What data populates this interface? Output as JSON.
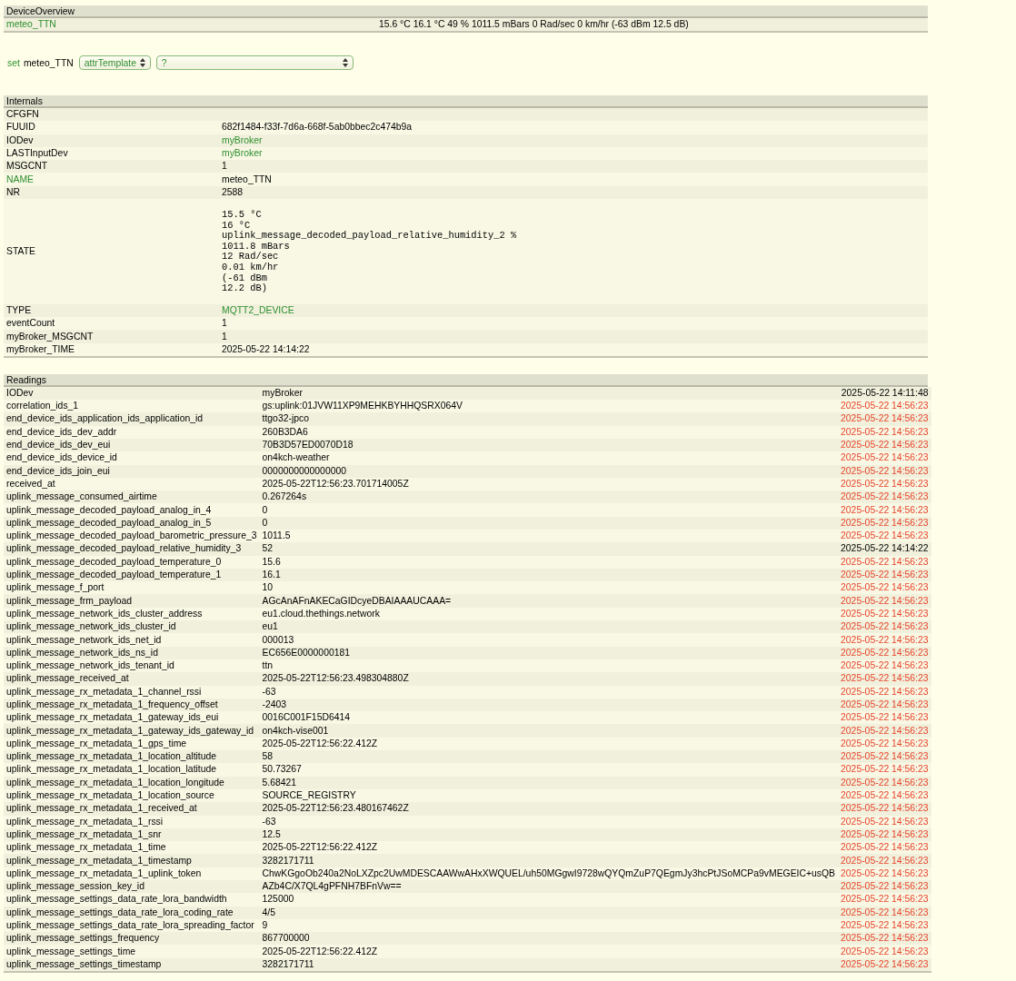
{
  "device_overview": {
    "title": "DeviceOverview",
    "device": "meteo_TTN",
    "state": "15.6 °C 16.1 °C 49 % 1011.5 mBars 0 Rad/sec 0 km/hr (-63 dBm 12.5 dB)"
  },
  "set_line": {
    "command": "set",
    "device": "meteo_TTN",
    "selects": [
      {
        "value": "attrTemplate"
      },
      {
        "value": "?"
      }
    ]
  },
  "internals": {
    "title": "Internals",
    "rows": [
      {
        "name": "CFGFN",
        "name_link": false
      },
      {
        "name": "FUUID",
        "name_link": false,
        "kind": "text",
        "value": "682f1484-f33f-7d6a-668f-5ab0bbec2c474b9a"
      },
      {
        "name": "IODev",
        "name_link": false,
        "kind": "link",
        "value": "myBroker"
      },
      {
        "name": "LASTInputDev",
        "name_link": false,
        "kind": "link",
        "value": "myBroker"
      },
      {
        "name": "MSGCNT",
        "name_link": false,
        "kind": "text",
        "value": "1"
      },
      {
        "name": "NAME",
        "name_link": true,
        "kind": "text",
        "value": "meteo_TTN"
      },
      {
        "name": "NR",
        "name_link": false,
        "kind": "text",
        "value": "2588"
      },
      {
        "name": "STATE",
        "name_link": false,
        "kind": "preformatted",
        "value": "15.5 °C\n16 °C\nuplink_message_decoded_payload_relative_humidity_2 %\n1011.8 mBars\n12 Rad/sec\n0.01 km/hr\n(-61 dBm\n12.2 dB)"
      },
      {
        "name": "TYPE",
        "name_link": false,
        "kind": "link",
        "value": "MQTT2_DEVICE"
      },
      {
        "name": "eventCount",
        "name_link": false,
        "kind": "text",
        "value": "1"
      },
      {
        "name": "myBroker_MSGCNT",
        "name_link": false,
        "kind": "text",
        "value": "1"
      },
      {
        "name": "myBroker_TIME",
        "name_link": false,
        "kind": "text",
        "value": "2025-05-22 14:14:22"
      }
    ]
  },
  "readings": {
    "title": "Readings",
    "rows": [
      {
        "name": "IODev",
        "value": "myBroker",
        "time": "2025-05-22 14:11:48",
        "color": "#000000"
      },
      {
        "name": "correlation_ids_1",
        "value": "gs:uplink:01JVW11XP9MEHKBYHHQSRX064V",
        "time": "2025-05-22 14:56:23",
        "color": "#e8452c"
      },
      {
        "name": "end_device_ids_application_ids_application_id",
        "value": "ttgo32-jpco",
        "time": "2025-05-22 14:56:23",
        "color": "#e8452c"
      },
      {
        "name": "end_device_ids_dev_addr",
        "value": "260B3DA6",
        "time": "2025-05-22 14:56:23",
        "color": "#e8452c"
      },
      {
        "name": "end_device_ids_dev_eui",
        "value": "70B3D57ED0070D18",
        "time": "2025-05-22 14:56:23",
        "color": "#e8452c"
      },
      {
        "name": "end_device_ids_device_id",
        "value": "on4kch-weather",
        "time": "2025-05-22 14:56:23",
        "color": "#e8452c"
      },
      {
        "name": "end_device_ids_join_eui",
        "value": "0000000000000000",
        "time": "2025-05-22 14:56:23",
        "color": "#e8452c"
      },
      {
        "name": "received_at",
        "value": "2025-05-22T12:56:23.701714005Z",
        "time": "2025-05-22 14:56:23",
        "color": "#e8452c"
      },
      {
        "name": "uplink_message_consumed_airtime",
        "value": "0.267264s",
        "time": "2025-05-22 14:56:23",
        "color": "#e8452c"
      },
      {
        "name": "uplink_message_decoded_payload_analog_in_4",
        "value": "0",
        "time": "2025-05-22 14:56:23",
        "color": "#e8452c"
      },
      {
        "name": "uplink_message_decoded_payload_analog_in_5",
        "value": "0",
        "time": "2025-05-22 14:56:23",
        "color": "#e8452c"
      },
      {
        "name": "uplink_message_decoded_payload_barometric_pressure_3",
        "value": "1011.5",
        "time": "2025-05-22 14:56:23",
        "color": "#e8452c"
      },
      {
        "name": "uplink_message_decoded_payload_relative_humidity_3",
        "value": "52",
        "time": "2025-05-22 14:14:22",
        "color": "#000000"
      },
      {
        "name": "uplink_message_decoded_payload_temperature_0",
        "value": "15.6",
        "time": "2025-05-22 14:56:23",
        "color": "#e8452c"
      },
      {
        "name": "uplink_message_decoded_payload_temperature_1",
        "value": "16.1",
        "time": "2025-05-22 14:56:23",
        "color": "#e8452c"
      },
      {
        "name": "uplink_message_f_port",
        "value": "10",
        "time": "2025-05-22 14:56:23",
        "color": "#e8452c"
      },
      {
        "name": "uplink_message_frm_payload",
        "value": "AGcAnAFnAKECaGIDcyeDBAIAAAUCAAA=",
        "time": "2025-05-22 14:56:23",
        "color": "#e8452c"
      },
      {
        "name": "uplink_message_network_ids_cluster_address",
        "value": "eu1.cloud.thethings.network",
        "time": "2025-05-22 14:56:23",
        "color": "#e8452c"
      },
      {
        "name": "uplink_message_network_ids_cluster_id",
        "value": "eu1",
        "time": "2025-05-22 14:56:23",
        "color": "#e8452c"
      },
      {
        "name": "uplink_message_network_ids_net_id",
        "value": "000013",
        "time": "2025-05-22 14:56:23",
        "color": "#e8452c"
      },
      {
        "name": "uplink_message_network_ids_ns_id",
        "value": "EC656E0000000181",
        "time": "2025-05-22 14:56:23",
        "color": "#e8452c"
      },
      {
        "name": "uplink_message_network_ids_tenant_id",
        "value": "ttn",
        "time": "2025-05-22 14:56:23",
        "color": "#e8452c"
      },
      {
        "name": "uplink_message_received_at",
        "value": "2025-05-22T12:56:23.498304880Z",
        "time": "2025-05-22 14:56:23",
        "color": "#e8452c"
      },
      {
        "name": "uplink_message_rx_metadata_1_channel_rssi",
        "value": "-63",
        "time": "2025-05-22 14:56:23",
        "color": "#e8452c"
      },
      {
        "name": "uplink_message_rx_metadata_1_frequency_offset",
        "value": "-2403",
        "time": "2025-05-22 14:56:23",
        "color": "#e8452c"
      },
      {
        "name": "uplink_message_rx_metadata_1_gateway_ids_eui",
        "value": "0016C001F15D6414",
        "time": "2025-05-22 14:56:23",
        "color": "#e8452c"
      },
      {
        "name": "uplink_message_rx_metadata_1_gateway_ids_gateway_id",
        "value": "on4kch-vise001",
        "time": "2025-05-22 14:56:23",
        "color": "#e8452c"
      },
      {
        "name": "uplink_message_rx_metadata_1_gps_time",
        "value": "2025-05-22T12:56:22.412Z",
        "time": "2025-05-22 14:56:23",
        "color": "#e8452c"
      },
      {
        "name": "uplink_message_rx_metadata_1_location_altitude",
        "value": "58",
        "time": "2025-05-22 14:56:23",
        "color": "#e8452c"
      },
      {
        "name": "uplink_message_rx_metadata_1_location_latitude",
        "value": "50.73267",
        "time": "2025-05-22 14:56:23",
        "color": "#e8452c"
      },
      {
        "name": "uplink_message_rx_metadata_1_location_longitude",
        "value": "5.68421",
        "time": "2025-05-22 14:56:23",
        "color": "#e8452c"
      },
      {
        "name": "uplink_message_rx_metadata_1_location_source",
        "value": "SOURCE_REGISTRY",
        "time": "2025-05-22 14:56:23",
        "color": "#e8452c"
      },
      {
        "name": "uplink_message_rx_metadata_1_received_at",
        "value": "2025-05-22T12:56:23.480167462Z",
        "time": "2025-05-22 14:56:23",
        "color": "#e8452c"
      },
      {
        "name": "uplink_message_rx_metadata_1_rssi",
        "value": "-63",
        "time": "2025-05-22 14:56:23",
        "color": "#e8452c"
      },
      {
        "name": "uplink_message_rx_metadata_1_snr",
        "value": "12.5",
        "time": "2025-05-22 14:56:23",
        "color": "#e8452c"
      },
      {
        "name": "uplink_message_rx_metadata_1_time",
        "value": "2025-05-22T12:56:22.412Z",
        "time": "2025-05-22 14:56:23",
        "color": "#e8452c"
      },
      {
        "name": "uplink_message_rx_metadata_1_timestamp",
        "value": "3282171711",
        "time": "2025-05-22 14:56:23",
        "color": "#e8452c"
      },
      {
        "name": "uplink_message_rx_metadata_1_uplink_token",
        "value": "ChwKGgoOb240a2NoLXZpc2UwMDESCAAWwAHxXWQUEL/uh50MGgwI9728wQYQmZuP7QEgmJy3hcPtJSoMCPa9vMEGEIC+usQB",
        "time": "2025-05-22 14:56:23",
        "color": "#e8452c"
      },
      {
        "name": "uplink_message_session_key_id",
        "value": "AZb4C/X7QL4gPFNH7BFnVw==",
        "time": "2025-05-22 14:56:23",
        "color": "#e8452c"
      },
      {
        "name": "uplink_message_settings_data_rate_lora_bandwidth",
        "value": "125000",
        "time": "2025-05-22 14:56:23",
        "color": "#e8452c"
      },
      {
        "name": "uplink_message_settings_data_rate_lora_coding_rate",
        "value": "4/5",
        "time": "2025-05-22 14:56:23",
        "color": "#e8452c"
      },
      {
        "name": "uplink_message_settings_data_rate_lora_spreading_factor",
        "value": "9",
        "time": "2025-05-22 14:56:23",
        "color": "#e8452c"
      },
      {
        "name": "uplink_message_settings_frequency",
        "value": "867700000",
        "time": "2025-05-22 14:56:23",
        "color": "#e8452c"
      },
      {
        "name": "uplink_message_settings_time",
        "value": "2025-05-22T12:56:22.412Z",
        "time": "2025-05-22 14:56:23",
        "color": "#e8452c"
      },
      {
        "name": "uplink_message_settings_timestamp",
        "value": "3282171711",
        "time": "2025-05-22 14:56:23",
        "color": "#e8452c"
      }
    ]
  }
}
